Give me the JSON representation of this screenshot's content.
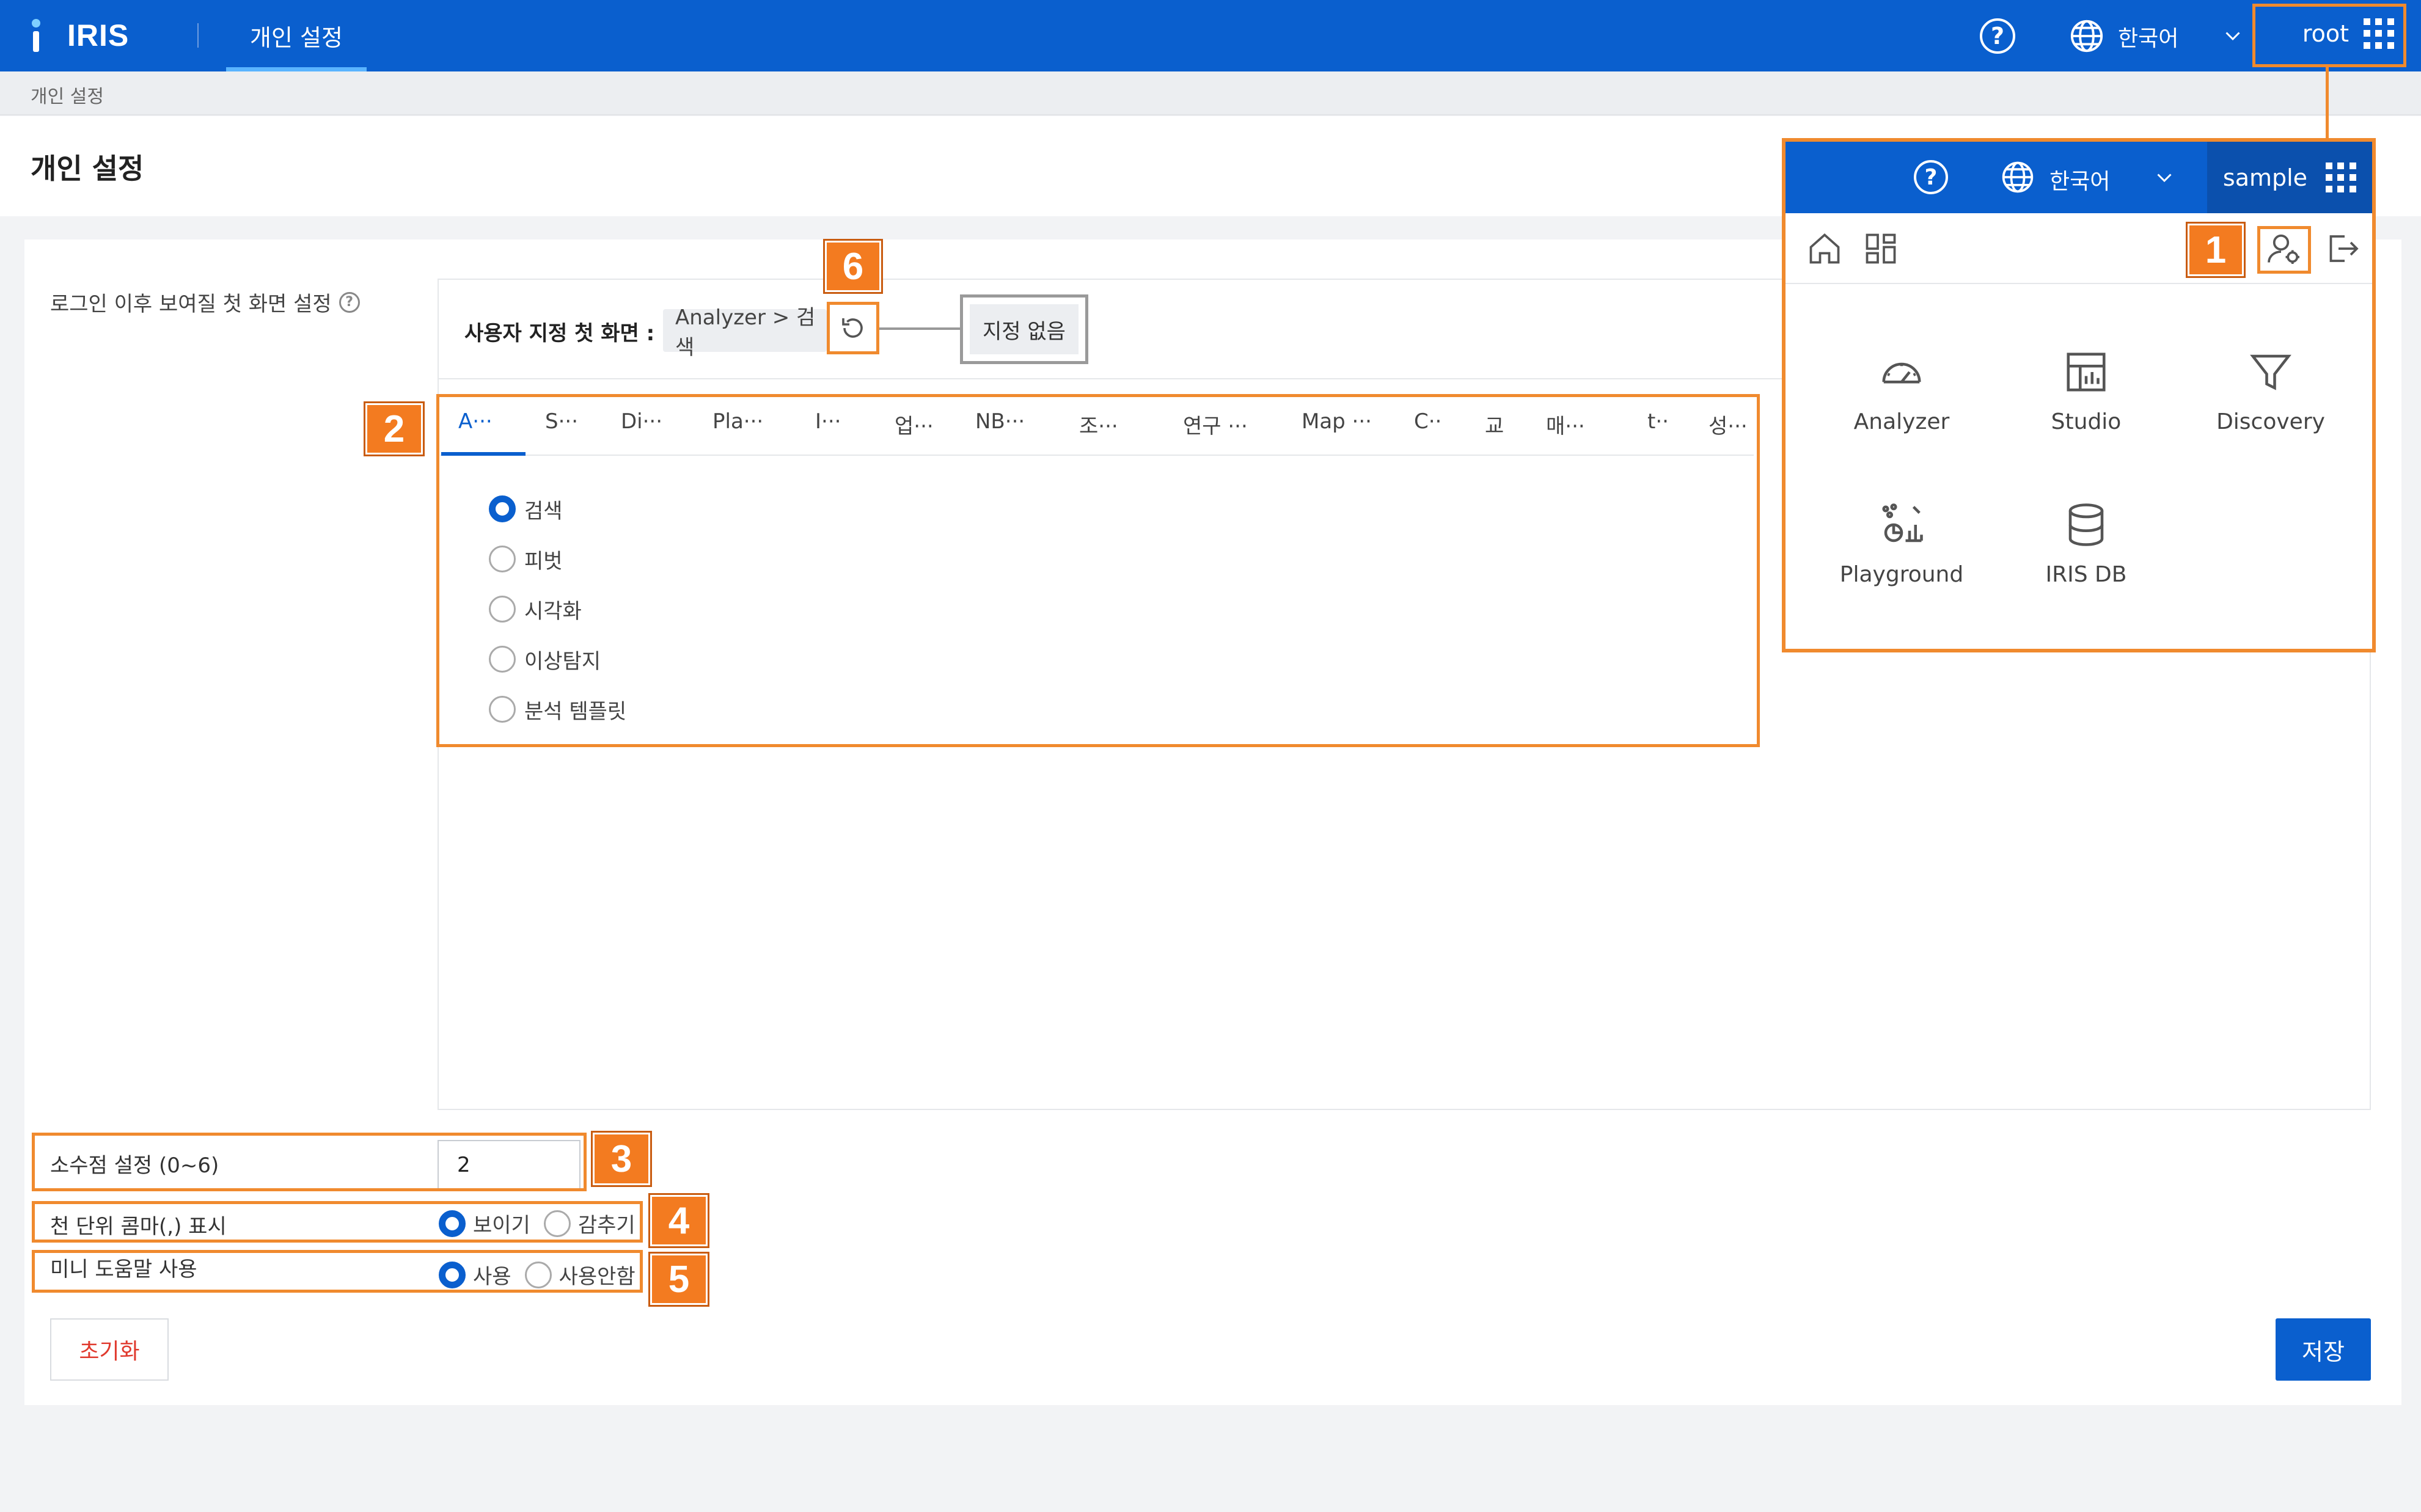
{
  "app": {
    "logo_text": "IRIS",
    "nav_tab": "개인 설정"
  },
  "topbar": {
    "language": "한국어",
    "user": "root",
    "help_icon": "question-circle-icon",
    "globe_icon": "globe-icon",
    "apps_icon": "apps-grid-icon"
  },
  "breadcrumb": "개인 설정",
  "page_title": "개인 설정",
  "first_screen": {
    "label": "로그인 이후 보여질 첫 화면 설정",
    "custom_label": "사용자 지정 첫 화면 :",
    "value": "Analyzer > 검색",
    "none_label": "지정 없음",
    "tabs": [
      "A···",
      "S···",
      "Di···",
      "Pla···",
      "I···",
      "업···",
      "NB···",
      "조···",
      "연구 ···",
      "Map ···",
      "C··",
      "교",
      "매···",
      "t··",
      "성···"
    ],
    "options": [
      {
        "label": "검색",
        "selected": true
      },
      {
        "label": "피벗",
        "selected": false
      },
      {
        "label": "시각화",
        "selected": false
      },
      {
        "label": "이상탐지",
        "selected": false
      },
      {
        "label": "분석 템플릿",
        "selected": false
      }
    ]
  },
  "decimal": {
    "label": "소수점 설정 (0~6)",
    "value": "2"
  },
  "comma": {
    "label": "천 단위 콤마(,) 표시",
    "show": "보이기",
    "hide": "감추기",
    "selected": "보이기"
  },
  "minihelp": {
    "label": "미니 도움말 사용",
    "use": "사용",
    "nouse": "사용안함",
    "selected": "사용"
  },
  "buttons": {
    "reset": "초기화",
    "save": "저장"
  },
  "badges": [
    "1",
    "2",
    "3",
    "4",
    "5",
    "6"
  ],
  "dropdown": {
    "language": "한국어",
    "user": "sample",
    "apps": [
      "Analyzer",
      "Studio",
      "Discovery",
      "Playground",
      "IRIS DB"
    ]
  },
  "colors": {
    "primary": "#0a5fce",
    "highlight": "#f08a2e",
    "badge": "#f37b20",
    "reset_text": "#e03a2e"
  }
}
